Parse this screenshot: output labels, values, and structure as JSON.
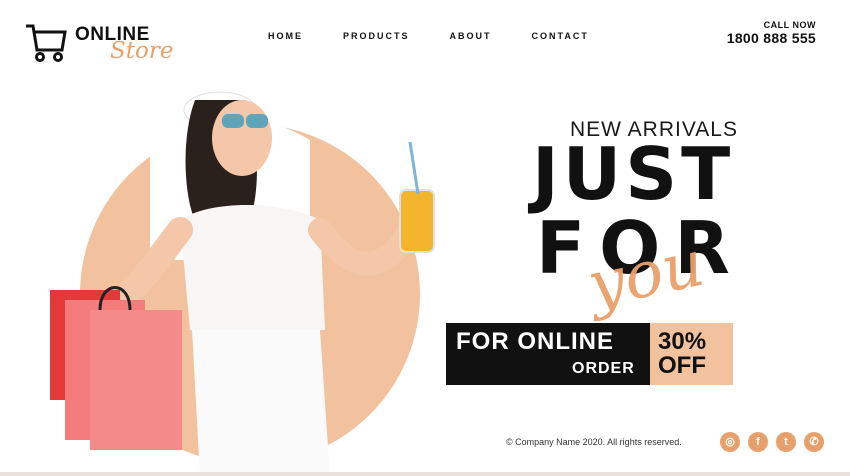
{
  "header": {
    "logo_top": "ONLINE",
    "logo_bottom": "Store",
    "nav": [
      "HOME",
      "PRODUCTS",
      "ABOUT",
      "CONTACT"
    ],
    "call_label": "CALL NOW",
    "call_number": "1800 888 555"
  },
  "hero": {
    "new_arrivals": "NEW ARRIVALS",
    "line_just": "JUST",
    "line_for": "FOR",
    "line_you": "you",
    "promo_line1": "FOR ONLINE",
    "promo_line2": "ORDER",
    "promo_percent": "30%",
    "promo_off": "OFF"
  },
  "footer": {
    "copyright": "© Company Name 2020. All rights reserved.",
    "social_icons": [
      "instagram-icon",
      "facebook-icon",
      "twitter-icon",
      "whatsapp-icon"
    ]
  },
  "colors": {
    "accent": "#e8a06b",
    "peach": "#f2c19e",
    "dark": "#111111"
  }
}
